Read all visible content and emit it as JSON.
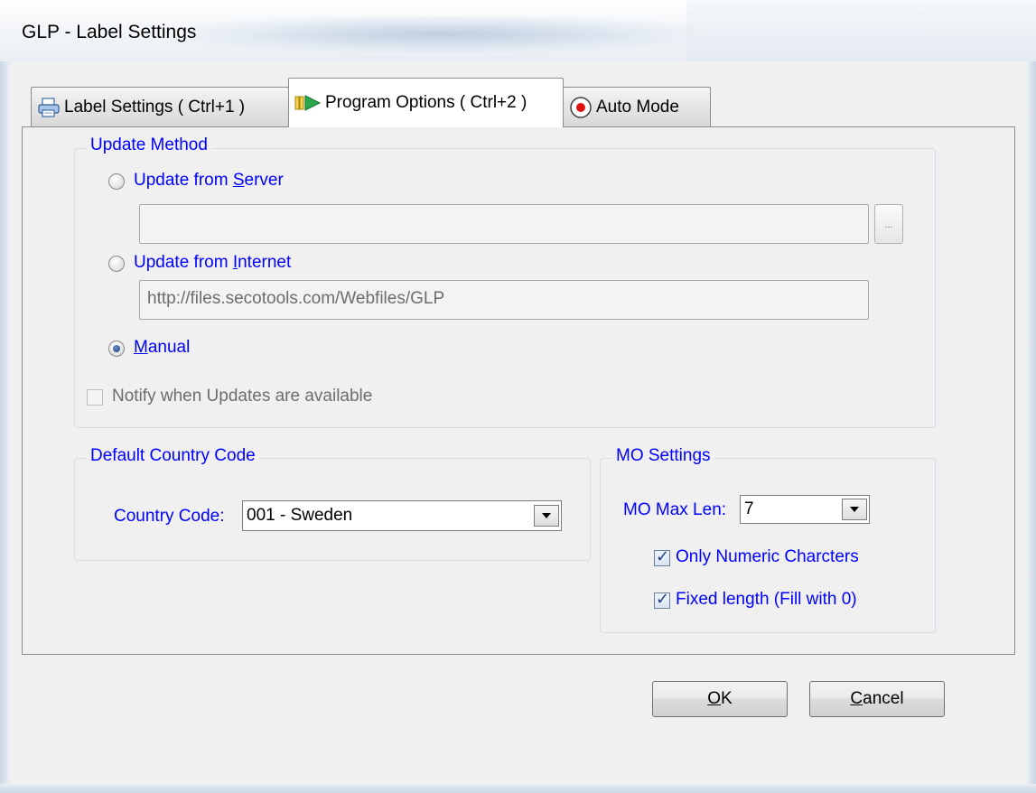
{
  "window": {
    "title": "GLP - Label Settings"
  },
  "tabs": [
    {
      "label": "Label Settings  ( Ctrl+1 )",
      "icon": "printer-icon",
      "active": false
    },
    {
      "label": "Program Options ( Ctrl+2 )",
      "icon": "play-program-icon",
      "active": true
    },
    {
      "label": "Auto Mode",
      "icon": "record-icon",
      "active": false
    }
  ],
  "update_method": {
    "group_title": "Update Method",
    "server": {
      "prefix": "Update from ",
      "mnemonic": "S",
      "suffix": "erver",
      "selected": false
    },
    "server_path": {
      "value": ""
    },
    "browse_label": "...",
    "internet": {
      "prefix": "Update from ",
      "mnemonic": "I",
      "suffix": "nternet",
      "selected": false
    },
    "internet_url": {
      "value": "http://files.secotools.com/Webfiles/GLP"
    },
    "manual": {
      "mnemonic": "M",
      "suffix": "anual",
      "selected": true
    },
    "notify": {
      "label": "Notify when Updates are available",
      "checked": false,
      "enabled": false
    }
  },
  "country": {
    "group_title": "Default Country Code",
    "label": "Country Code:",
    "value": "001 - Sweden"
  },
  "mo_settings": {
    "group_title": "MO Settings",
    "max_len_label": "MO Max Len:",
    "max_len_value": "7",
    "only_numeric": {
      "label": "Only Numeric Charcters",
      "checked": true
    },
    "fixed_length": {
      "label": "Fixed length (Fill with 0)",
      "checked": true
    }
  },
  "buttons": {
    "ok": {
      "mnemonic": "O",
      "suffix": "K"
    },
    "cancel": {
      "mnemonic": "C",
      "suffix": "ancel"
    }
  },
  "colors": {
    "label_blue": "#0000ff",
    "disabled_gray": "#6d6d6d",
    "dialog_bg": "#f0f0f0"
  }
}
